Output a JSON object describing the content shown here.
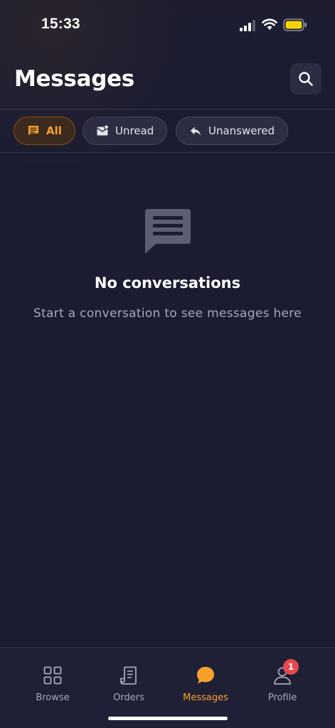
{
  "status_bar": {
    "time": "15:33",
    "icons": [
      "signal-icon",
      "wifi-icon",
      "battery-icon"
    ],
    "battery_color": "#f5d20a"
  },
  "header": {
    "title": "Messages",
    "search_icon": "search-icon"
  },
  "filters": [
    {
      "label": "All",
      "icon": "chat-icon",
      "active": true
    },
    {
      "label": "Unread",
      "icon": "unread-mail-icon",
      "active": false
    },
    {
      "label": "Unanswered",
      "icon": "reply-icon",
      "active": false
    }
  ],
  "empty_state": {
    "icon": "message-bubble-icon",
    "title": "No conversations",
    "subtitle": "Start a conversation to see messages here"
  },
  "bottom_nav": {
    "items": [
      {
        "label": "Browse",
        "icon": "grid-icon",
        "active": false
      },
      {
        "label": "Orders",
        "icon": "receipt-icon",
        "active": false
      },
      {
        "label": "Messages",
        "icon": "chat-bubble-icon",
        "active": true
      },
      {
        "label": "Profile",
        "icon": "user-icon",
        "active": false,
        "badge": "1"
      }
    ]
  },
  "colors": {
    "background": "#1b1c32",
    "accent": "#f7a12c",
    "badge": "#e5484d",
    "muted_text": "#a7a8b8"
  }
}
